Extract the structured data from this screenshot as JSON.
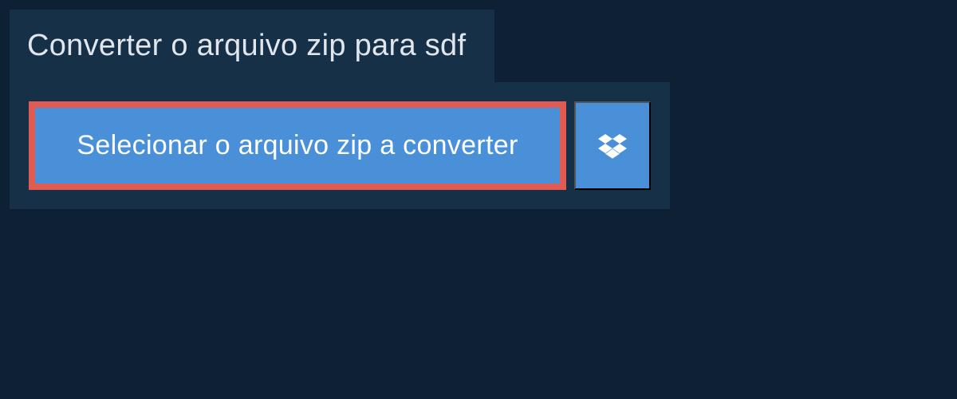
{
  "header": {
    "title": "Converter o arquivo zip para sdf"
  },
  "buttons": {
    "select_file_label": "Selecionar o arquivo zip a converter"
  }
}
